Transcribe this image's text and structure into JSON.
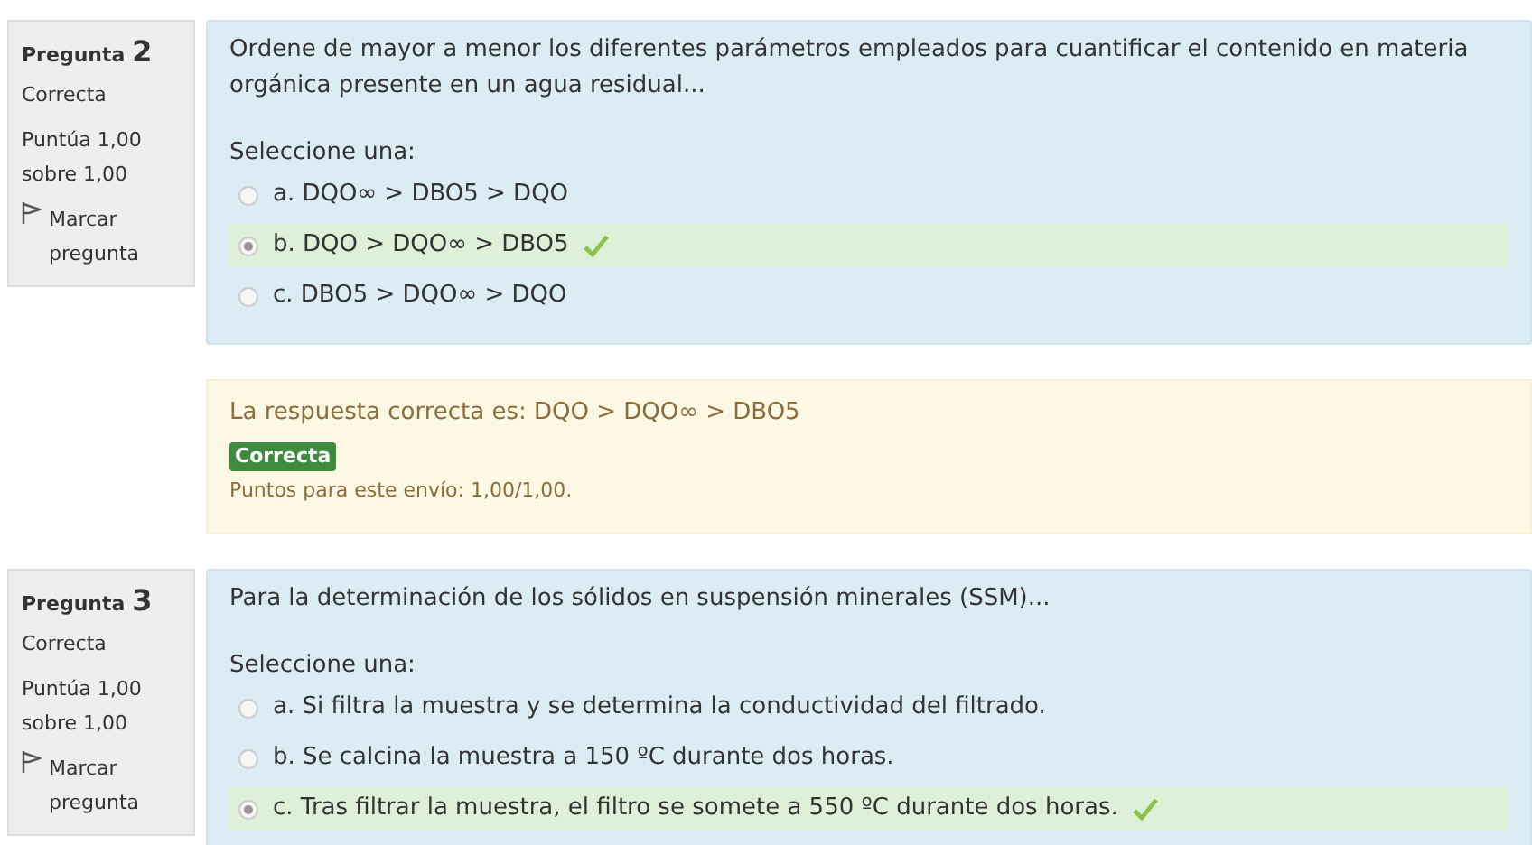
{
  "questions": [
    {
      "label": "Pregunta",
      "number": "2",
      "status": "Correcta",
      "score": "Puntúa 1,00 sobre 1,00",
      "flag": "Marcar pregunta",
      "text": "Ordene de mayor a menor los diferentes parámetros empleados para cuantificar el contenido en materia orgánica presente en un agua residual...",
      "prompt": "Seleccione una:",
      "options": [
        {
          "text": "a. DQO∞ > DBO5 > DQO",
          "selected": false
        },
        {
          "text": "b. DQO > DQO∞ > DBO5",
          "selected": true
        },
        {
          "text": "c. DBO5 > DQO∞ > DQO",
          "selected": false
        }
      ],
      "feedback": {
        "answer": "La respuesta correcta es: DQO > DQO∞ > DBO5",
        "badge": "Correcta",
        "points": "Puntos para este envío: 1,00/1,00."
      }
    },
    {
      "label": "Pregunta",
      "number": "3",
      "status": "Correcta",
      "score": "Puntúa 1,00 sobre 1,00",
      "flag": "Marcar pregunta",
      "text": "Para la determinación de los sólidos en suspensión minerales (SSM)...",
      "prompt": "Seleccione una:",
      "options": [
        {
          "text": "a. Si filtra la muestra y se determina la conductividad del filtrado.",
          "selected": false
        },
        {
          "text": "b. Se calcina la muestra a 150 ºC durante dos horas.",
          "selected": false
        },
        {
          "text": "c. Tras filtrar la muestra, el filtro se somete a 550 ºC durante dos horas.",
          "selected": true
        }
      ]
    }
  ]
}
